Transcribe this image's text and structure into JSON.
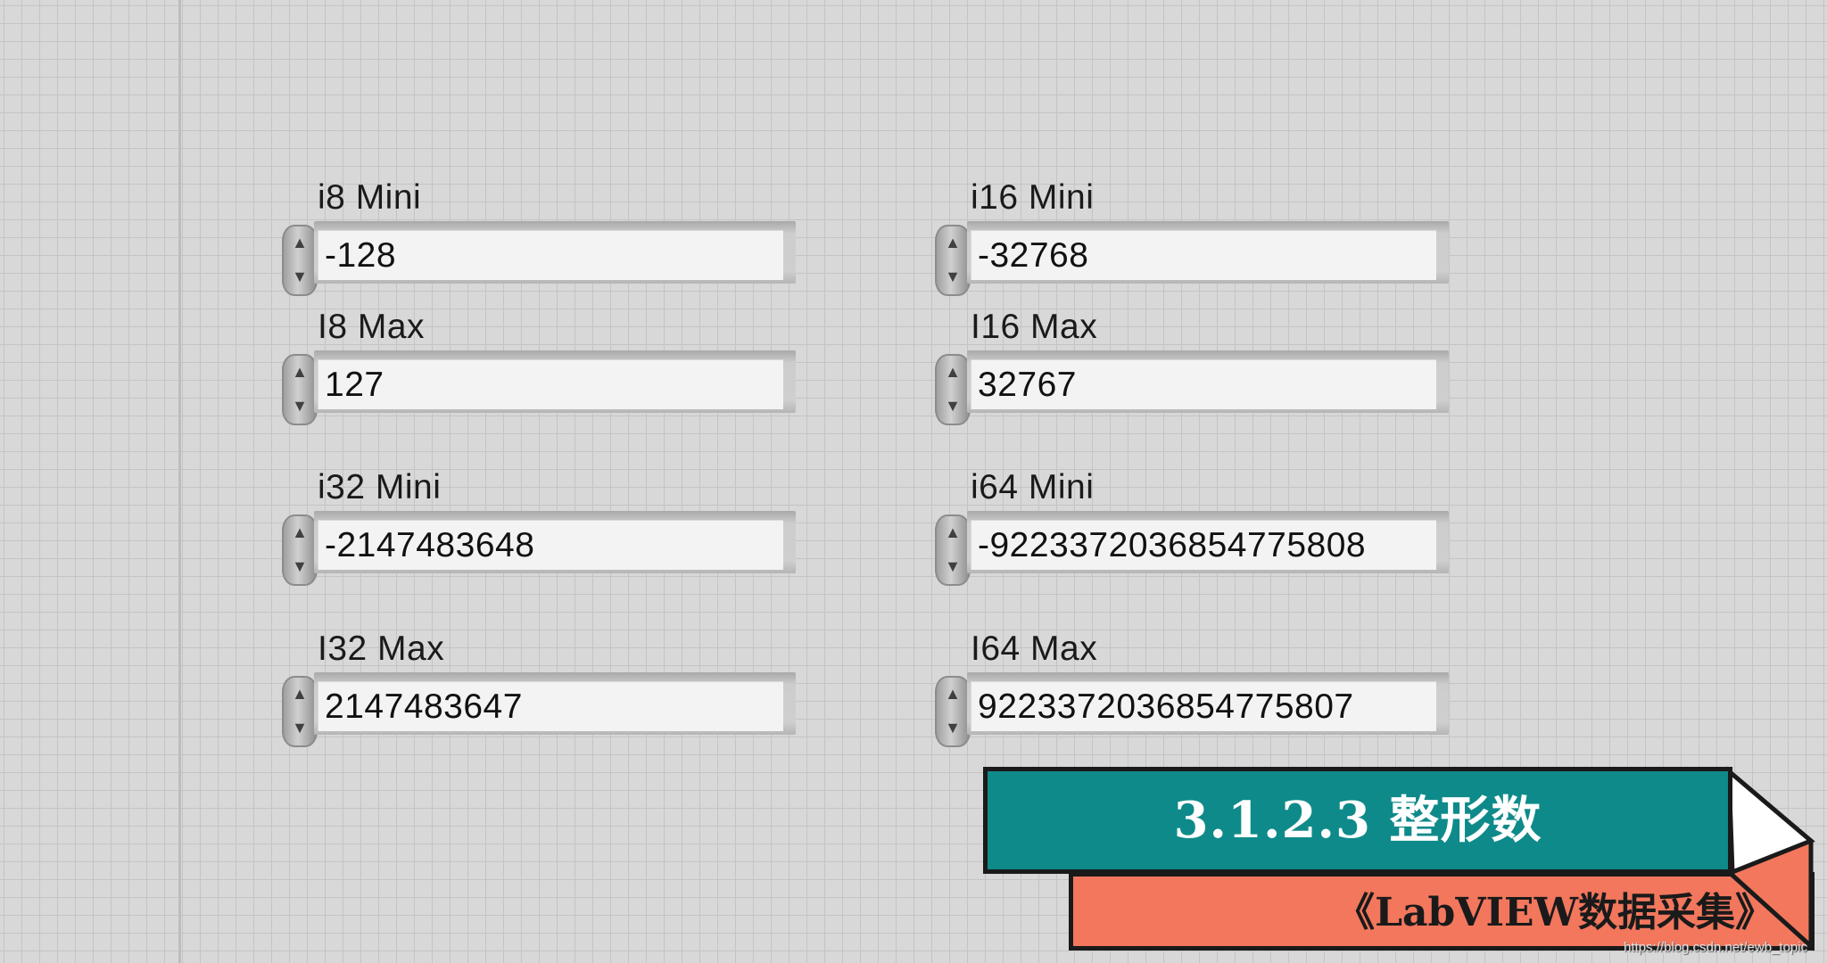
{
  "controls": [
    {
      "label": "i8 Mini",
      "value": "-128"
    },
    {
      "label": "I8 Max",
      "value": "127"
    },
    {
      "label": "i32 Mini",
      "value": "-2147483648"
    },
    {
      "label": "I32 Max",
      "value": "2147483647"
    },
    {
      "label": "i16 Mini",
      "value": "-32768"
    },
    {
      "label": "I16 Max",
      "value": "32767"
    },
    {
      "label": "i64 Mini",
      "value": "-9223372036854775808"
    },
    {
      "label": "I64 Max",
      "value": "9223372036854775807"
    }
  ],
  "banner": {
    "title": "3.1.2.3 整形数",
    "subtitle": "《LabVIEW数据采集》",
    "link": "https://blog.csdn.net/ewb_topic"
  },
  "colors": {
    "banner_teal": "#0f8a8a",
    "banner_coral": "#f2775d"
  },
  "icons": {
    "increment": "up-arrow-icon",
    "decrement": "down-arrow-icon"
  }
}
